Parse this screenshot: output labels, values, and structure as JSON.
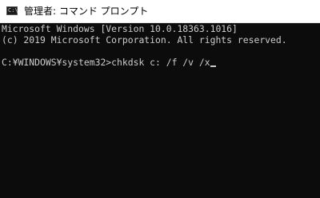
{
  "window": {
    "title": "管理者: コマンド プロンプト",
    "icon": "cmd-console-icon"
  },
  "console": {
    "lines": [
      "Microsoft Windows [Version 10.0.18363.1016]",
      "(c) 2019 Microsoft Corporation. All rights reserved."
    ],
    "prompt_line": "C:¥WINDOWS¥system32>chkdsk c: /f /v /x"
  },
  "colors": {
    "console_background": "#0c0c0c",
    "console_text": "#cccccc",
    "titlebar_background": "#ffffff"
  }
}
